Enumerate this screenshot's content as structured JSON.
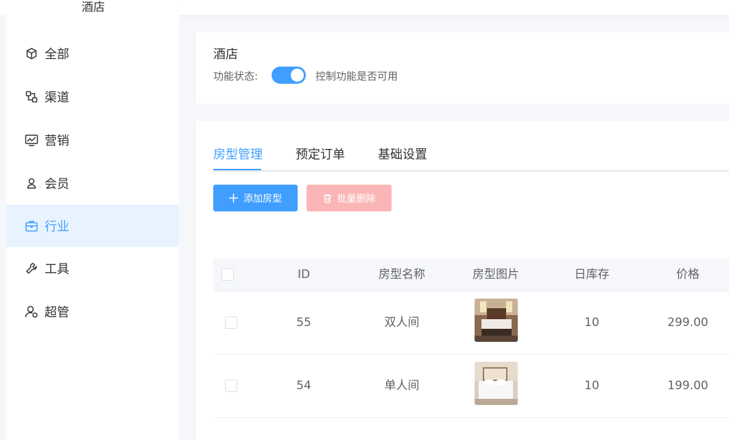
{
  "sidebar": {
    "title": "酒店",
    "items": [
      {
        "label": "全部",
        "icon": "cube-icon"
      },
      {
        "label": "渠道",
        "icon": "channel-icon"
      },
      {
        "label": "营销",
        "icon": "marketing-chart-icon"
      },
      {
        "label": "会员",
        "icon": "member-icon"
      },
      {
        "label": "行业",
        "icon": "briefcase-icon"
      },
      {
        "label": "工具",
        "icon": "wrench-icon"
      },
      {
        "label": "超管",
        "icon": "admin-user-icon"
      }
    ],
    "active_index": 4
  },
  "feature": {
    "name": "酒店",
    "status_label": "功能状态:",
    "enabled": true,
    "status_desc": "控制功能是否可用"
  },
  "tabs": [
    "房型管理",
    "预定订单",
    "基础设置"
  ],
  "active_tab": 0,
  "actions": {
    "add_label": "添加房型",
    "delete_label": "批量删除"
  },
  "table": {
    "headers": [
      "ID",
      "房型名称",
      "房型图片",
      "日库存",
      "价格"
    ],
    "rows": [
      {
        "id": "55",
        "name": "双人间",
        "stock": "10",
        "price": "299.00"
      },
      {
        "id": "54",
        "name": "单人间",
        "stock": "10",
        "price": "199.00"
      }
    ]
  },
  "colors": {
    "primary": "#409eff",
    "active_bg": "#e8f3ff",
    "danger_disabled": "#fab6b6"
  }
}
